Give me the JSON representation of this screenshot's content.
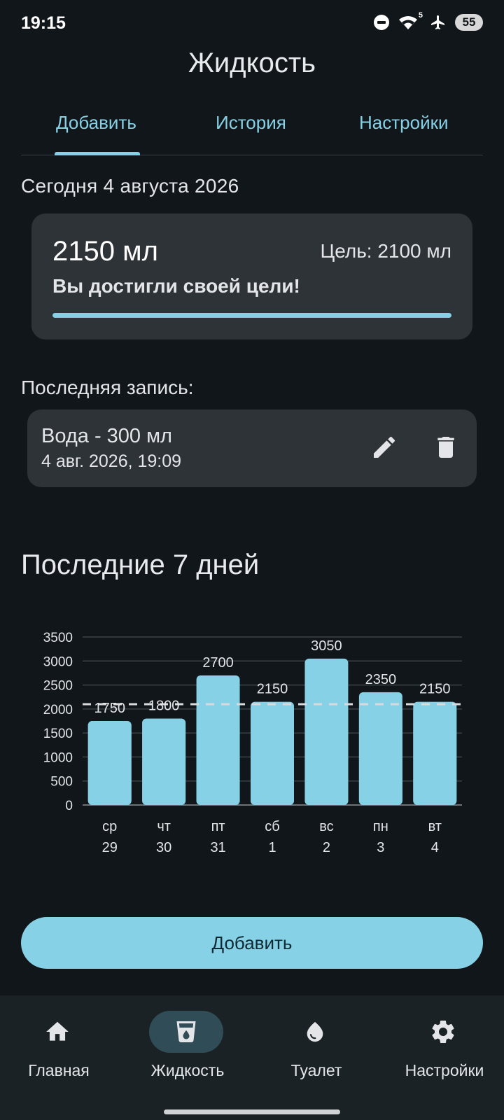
{
  "status_bar": {
    "time": "19:15",
    "wifi_badge": "5",
    "battery": "55"
  },
  "app_title": "Жидкость",
  "tabs": [
    {
      "label": "Добавить",
      "active": true
    },
    {
      "label": "История",
      "active": false
    },
    {
      "label": "Настройки",
      "active": false
    }
  ],
  "today_label": "Сегодня 4 августа 2026",
  "summary": {
    "amount": "2150 мл",
    "goal": "Цель: 2100 мл",
    "message": "Вы достигли своей цели!",
    "progress": 1.0
  },
  "last_entry": {
    "label": "Последняя запись:",
    "title": "Вода - 300 мл",
    "date": "4 авг. 2026, 19:09",
    "edit_icon": "pencil-icon",
    "delete_icon": "trash-icon"
  },
  "week_title": "Последние 7 дней",
  "chart_data": {
    "type": "bar",
    "categories": [
      "ср\n29",
      "чт\n30",
      "пт\n31",
      "сб\n1",
      "вс\n2",
      "пн\n3",
      "вт\n4"
    ],
    "weekdays": [
      "ср",
      "чт",
      "пт",
      "сб",
      "вс",
      "пн",
      "вт"
    ],
    "days": [
      "29",
      "30",
      "31",
      "1",
      "2",
      "3",
      "4"
    ],
    "values": [
      1750,
      1800,
      2700,
      2150,
      3050,
      2350,
      2150
    ],
    "goal_line": 2100,
    "ylim": [
      0,
      3500
    ],
    "yticks": [
      0,
      500,
      1000,
      1500,
      2000,
      2500,
      3000,
      3500
    ],
    "grid": true,
    "bar_color": "#86d1e6",
    "title": "",
    "xlabel": "",
    "ylabel": ""
  },
  "add_button": "Добавить",
  "bottom_nav": [
    {
      "label": "Главная",
      "icon": "home-icon",
      "active": false
    },
    {
      "label": "Жидкость",
      "icon": "cup-icon",
      "active": true
    },
    {
      "label": "Туалет",
      "icon": "drop-icon",
      "active": false
    },
    {
      "label": "Настройки",
      "icon": "gear-icon",
      "active": false
    }
  ],
  "colors": {
    "accent": "#86d1e6",
    "background": "#11161a",
    "card": "#2e3337"
  }
}
